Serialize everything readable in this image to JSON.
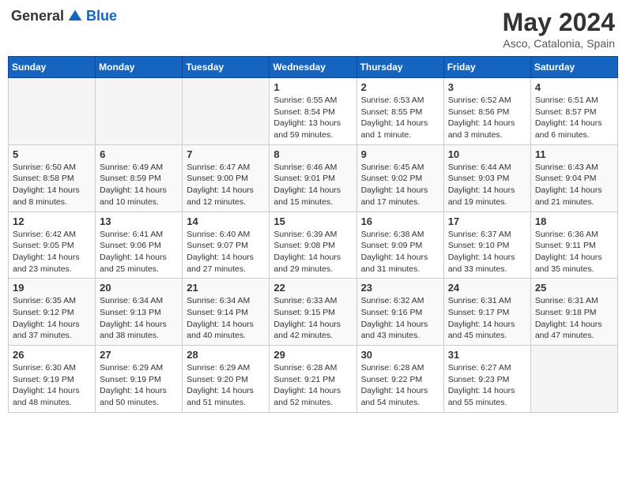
{
  "header": {
    "logo_general": "General",
    "logo_blue": "Blue",
    "month": "May 2024",
    "location": "Asco, Catalonia, Spain"
  },
  "weekdays": [
    "Sunday",
    "Monday",
    "Tuesday",
    "Wednesday",
    "Thursday",
    "Friday",
    "Saturday"
  ],
  "weeks": [
    [
      {
        "day": "",
        "sunrise": "",
        "sunset": "",
        "daylight": ""
      },
      {
        "day": "",
        "sunrise": "",
        "sunset": "",
        "daylight": ""
      },
      {
        "day": "",
        "sunrise": "",
        "sunset": "",
        "daylight": ""
      },
      {
        "day": "1",
        "sunrise": "Sunrise: 6:55 AM",
        "sunset": "Sunset: 8:54 PM",
        "daylight": "Daylight: 13 hours and 59 minutes."
      },
      {
        "day": "2",
        "sunrise": "Sunrise: 6:53 AM",
        "sunset": "Sunset: 8:55 PM",
        "daylight": "Daylight: 14 hours and 1 minute."
      },
      {
        "day": "3",
        "sunrise": "Sunrise: 6:52 AM",
        "sunset": "Sunset: 8:56 PM",
        "daylight": "Daylight: 14 hours and 3 minutes."
      },
      {
        "day": "4",
        "sunrise": "Sunrise: 6:51 AM",
        "sunset": "Sunset: 8:57 PM",
        "daylight": "Daylight: 14 hours and 6 minutes."
      }
    ],
    [
      {
        "day": "5",
        "sunrise": "Sunrise: 6:50 AM",
        "sunset": "Sunset: 8:58 PM",
        "daylight": "Daylight: 14 hours and 8 minutes."
      },
      {
        "day": "6",
        "sunrise": "Sunrise: 6:49 AM",
        "sunset": "Sunset: 8:59 PM",
        "daylight": "Daylight: 14 hours and 10 minutes."
      },
      {
        "day": "7",
        "sunrise": "Sunrise: 6:47 AM",
        "sunset": "Sunset: 9:00 PM",
        "daylight": "Daylight: 14 hours and 12 minutes."
      },
      {
        "day": "8",
        "sunrise": "Sunrise: 6:46 AM",
        "sunset": "Sunset: 9:01 PM",
        "daylight": "Daylight: 14 hours and 15 minutes."
      },
      {
        "day": "9",
        "sunrise": "Sunrise: 6:45 AM",
        "sunset": "Sunset: 9:02 PM",
        "daylight": "Daylight: 14 hours and 17 minutes."
      },
      {
        "day": "10",
        "sunrise": "Sunrise: 6:44 AM",
        "sunset": "Sunset: 9:03 PM",
        "daylight": "Daylight: 14 hours and 19 minutes."
      },
      {
        "day": "11",
        "sunrise": "Sunrise: 6:43 AM",
        "sunset": "Sunset: 9:04 PM",
        "daylight": "Daylight: 14 hours and 21 minutes."
      }
    ],
    [
      {
        "day": "12",
        "sunrise": "Sunrise: 6:42 AM",
        "sunset": "Sunset: 9:05 PM",
        "daylight": "Daylight: 14 hours and 23 minutes."
      },
      {
        "day": "13",
        "sunrise": "Sunrise: 6:41 AM",
        "sunset": "Sunset: 9:06 PM",
        "daylight": "Daylight: 14 hours and 25 minutes."
      },
      {
        "day": "14",
        "sunrise": "Sunrise: 6:40 AM",
        "sunset": "Sunset: 9:07 PM",
        "daylight": "Daylight: 14 hours and 27 minutes."
      },
      {
        "day": "15",
        "sunrise": "Sunrise: 6:39 AM",
        "sunset": "Sunset: 9:08 PM",
        "daylight": "Daylight: 14 hours and 29 minutes."
      },
      {
        "day": "16",
        "sunrise": "Sunrise: 6:38 AM",
        "sunset": "Sunset: 9:09 PM",
        "daylight": "Daylight: 14 hours and 31 minutes."
      },
      {
        "day": "17",
        "sunrise": "Sunrise: 6:37 AM",
        "sunset": "Sunset: 9:10 PM",
        "daylight": "Daylight: 14 hours and 33 minutes."
      },
      {
        "day": "18",
        "sunrise": "Sunrise: 6:36 AM",
        "sunset": "Sunset: 9:11 PM",
        "daylight": "Daylight: 14 hours and 35 minutes."
      }
    ],
    [
      {
        "day": "19",
        "sunrise": "Sunrise: 6:35 AM",
        "sunset": "Sunset: 9:12 PM",
        "daylight": "Daylight: 14 hours and 37 minutes."
      },
      {
        "day": "20",
        "sunrise": "Sunrise: 6:34 AM",
        "sunset": "Sunset: 9:13 PM",
        "daylight": "Daylight: 14 hours and 38 minutes."
      },
      {
        "day": "21",
        "sunrise": "Sunrise: 6:34 AM",
        "sunset": "Sunset: 9:14 PM",
        "daylight": "Daylight: 14 hours and 40 minutes."
      },
      {
        "day": "22",
        "sunrise": "Sunrise: 6:33 AM",
        "sunset": "Sunset: 9:15 PM",
        "daylight": "Daylight: 14 hours and 42 minutes."
      },
      {
        "day": "23",
        "sunrise": "Sunrise: 6:32 AM",
        "sunset": "Sunset: 9:16 PM",
        "daylight": "Daylight: 14 hours and 43 minutes."
      },
      {
        "day": "24",
        "sunrise": "Sunrise: 6:31 AM",
        "sunset": "Sunset: 9:17 PM",
        "daylight": "Daylight: 14 hours and 45 minutes."
      },
      {
        "day": "25",
        "sunrise": "Sunrise: 6:31 AM",
        "sunset": "Sunset: 9:18 PM",
        "daylight": "Daylight: 14 hours and 47 minutes."
      }
    ],
    [
      {
        "day": "26",
        "sunrise": "Sunrise: 6:30 AM",
        "sunset": "Sunset: 9:19 PM",
        "daylight": "Daylight: 14 hours and 48 minutes."
      },
      {
        "day": "27",
        "sunrise": "Sunrise: 6:29 AM",
        "sunset": "Sunset: 9:19 PM",
        "daylight": "Daylight: 14 hours and 50 minutes."
      },
      {
        "day": "28",
        "sunrise": "Sunrise: 6:29 AM",
        "sunset": "Sunset: 9:20 PM",
        "daylight": "Daylight: 14 hours and 51 minutes."
      },
      {
        "day": "29",
        "sunrise": "Sunrise: 6:28 AM",
        "sunset": "Sunset: 9:21 PM",
        "daylight": "Daylight: 14 hours and 52 minutes."
      },
      {
        "day": "30",
        "sunrise": "Sunrise: 6:28 AM",
        "sunset": "Sunset: 9:22 PM",
        "daylight": "Daylight: 14 hours and 54 minutes."
      },
      {
        "day": "31",
        "sunrise": "Sunrise: 6:27 AM",
        "sunset": "Sunset: 9:23 PM",
        "daylight": "Daylight: 14 hours and 55 minutes."
      },
      {
        "day": "",
        "sunrise": "",
        "sunset": "",
        "daylight": ""
      }
    ]
  ]
}
